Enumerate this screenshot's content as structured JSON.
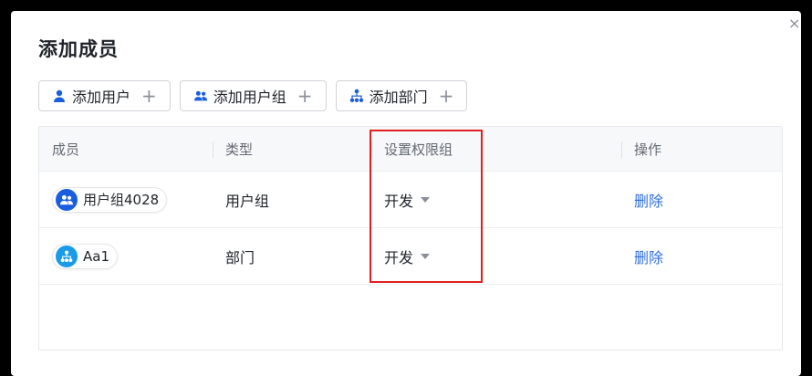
{
  "dialog": {
    "title": "添加成员",
    "close_glyph": "×"
  },
  "actions": [
    {
      "label": "添加用户",
      "icon": "user-icon",
      "plus": "+"
    },
    {
      "label": "添加用户组",
      "icon": "user-group-icon",
      "plus": "+"
    },
    {
      "label": "添加部门",
      "icon": "department-icon",
      "plus": "+"
    }
  ],
  "table": {
    "columns": [
      "成员",
      "类型",
      "设置权限组",
      "操作"
    ],
    "rows": [
      {
        "member": "用户组4028",
        "avatar_icon": "user-group-icon",
        "type": "用户组",
        "permission": "开发",
        "action": "删除"
      },
      {
        "member": "Aa1",
        "avatar_icon": "department-icon",
        "type": "部门",
        "permission": "开发",
        "action": "删除"
      }
    ]
  },
  "colors": {
    "accent": "#2f6fe0",
    "group_avatar": "#1a5ee0",
    "dept_avatar": "#1a9bea",
    "highlight_box": "#e02020"
  }
}
